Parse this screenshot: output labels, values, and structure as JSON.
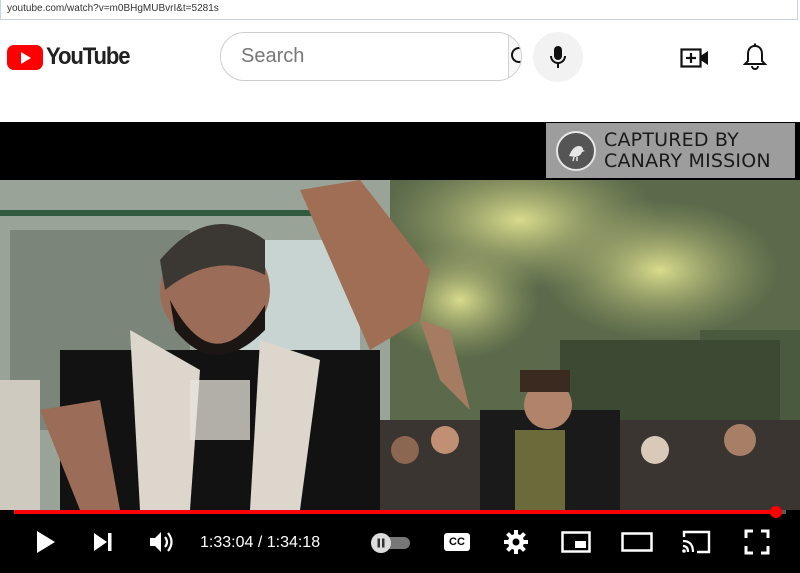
{
  "browser": {
    "url": "youtube.com/watch?v=m0BHgMUBvrI&t=5281s"
  },
  "header": {
    "logo_text": "YouTube",
    "search_placeholder": "Search",
    "search_value": ""
  },
  "colors": {
    "brand": "#ff0000",
    "progress": "#ff0000"
  },
  "player": {
    "watermark_line1": "CAPTURED BY",
    "watermark_line2": "CANARY MISSION",
    "current_time": "1:33:04",
    "duration": "1:34:18",
    "time_display": "1:33:04 / 1:34:18",
    "progress_fraction": 0.987,
    "cc_label": "CC",
    "icons": [
      "play-icon",
      "next-icon",
      "volume-icon",
      "autoplay-toggle",
      "cc-icon",
      "settings-icon",
      "miniplayer-icon",
      "theater-icon",
      "cast-icon",
      "fullscreen-icon"
    ]
  }
}
